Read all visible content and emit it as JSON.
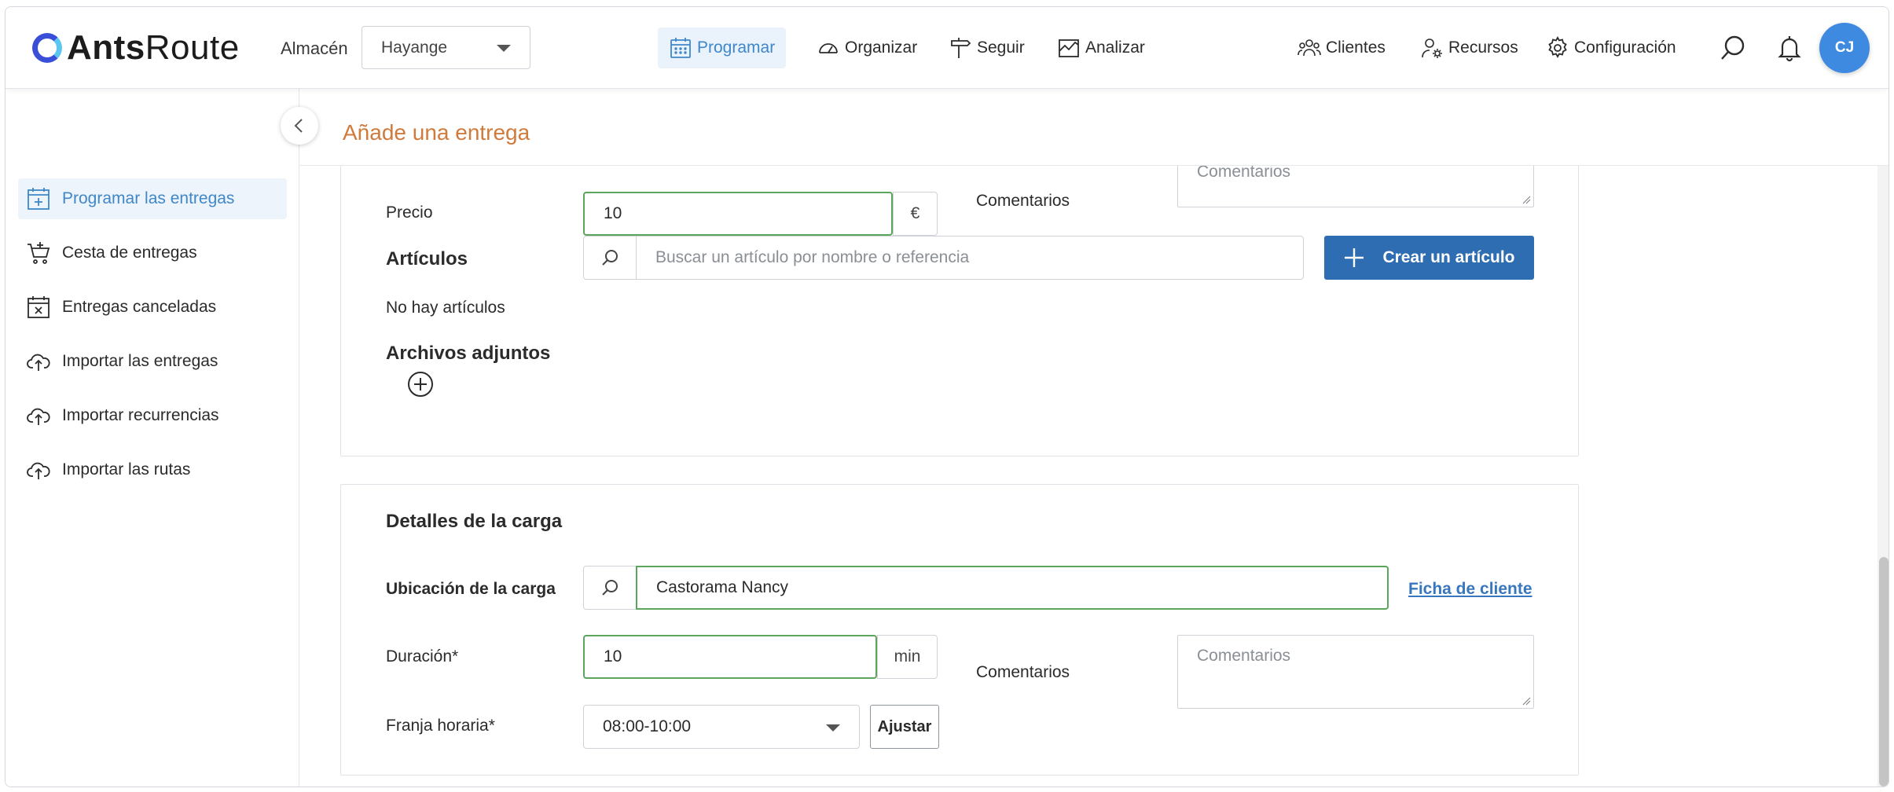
{
  "header": {
    "logo_bold": "Ants",
    "logo_light": "Route",
    "warehouse_label": "Almacén",
    "warehouse_value": "Hayange",
    "nav": {
      "programar": "Programar",
      "organizar": "Organizar",
      "seguir": "Seguir",
      "analizar": "Analizar",
      "clientes": "Clientes",
      "recursos": "Recursos",
      "configuracion": "Configuración"
    },
    "avatar_initials": "CJ"
  },
  "sidebar": {
    "items": [
      {
        "label": "Programar las entregas",
        "icon": "calendar-plus-icon",
        "active": true
      },
      {
        "label": "Cesta de entregas",
        "icon": "cart-icon"
      },
      {
        "label": "Entregas canceladas",
        "icon": "calendar-x-icon"
      },
      {
        "label": "Importar las entregas",
        "icon": "cloud-upload-icon"
      },
      {
        "label": "Importar recurrencias",
        "icon": "cloud-upload-icon"
      },
      {
        "label": "Importar las rutas",
        "icon": "cloud-upload-icon"
      }
    ]
  },
  "page": {
    "title": "Añade una entrega"
  },
  "delivery": {
    "price_label": "Precio",
    "price_value": "10",
    "currency": "€",
    "comments_label": "Comentarios",
    "comments_placeholder": "Comentarios",
    "articles_heading": "Artículos",
    "article_search_placeholder": "Buscar un artículo por nombre o referencia",
    "create_article_label": "Crear un artículo",
    "no_articles_text": "No hay artículos",
    "attachments_heading": "Archivos adjuntos"
  },
  "load": {
    "heading": "Detalles de la carga",
    "location_label": "Ubicación de la carga",
    "location_value": "Castorama Nancy",
    "client_link": "Ficha de cliente",
    "duration_label": "Duración*",
    "duration_value": "10",
    "duration_unit": "min",
    "comments_label": "Comentarios",
    "comments_placeholder": "Comentarios",
    "timeslot_label": "Franja horaria*",
    "timeslot_value": "08:00-10:00",
    "adjust_label": "Ajustar"
  },
  "colors": {
    "accent_blue": "#3f87c9",
    "primary_button": "#2f6db3",
    "title_orange": "#d07a3c",
    "valid_green": "#5aa65d"
  }
}
